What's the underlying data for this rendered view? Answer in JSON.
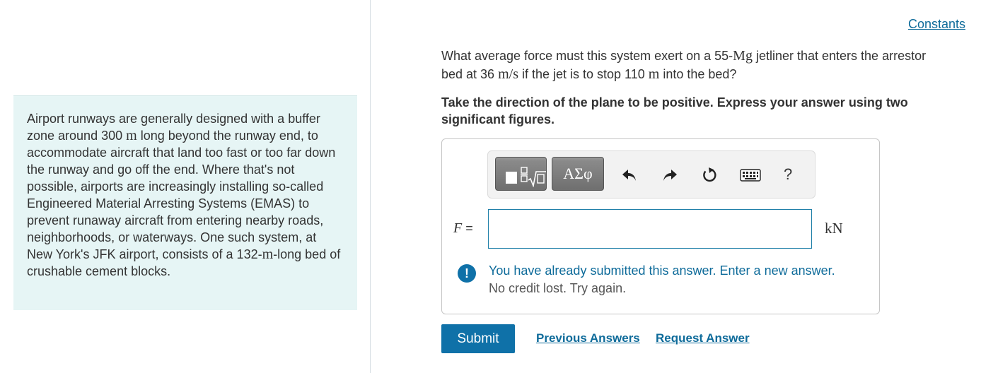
{
  "constants_link": "Constants",
  "intro": {
    "part1": "Airport runways are generally designed with a buffer zone around 300 ",
    "unit_m1": "m",
    "part2": " long beyond the runway end, to accommodate aircraft that land too fast or too far down the runway and go off the end. Where that's not possible, airports are increasingly installing so-called Engineered Material Arresting Systems (EMAS) to prevent runaway aircraft from entering nearby roads, neighborhoods, or waterways. One such system, at New York's JFK airport, consists of a 132-",
    "unit_m2": "m",
    "part3": "-long bed of crushable cement blocks."
  },
  "question": {
    "part1": "What average force must this system exert on a 55-",
    "unit_mg": "Mg",
    "part2": " jetliner that enters the arrestor bed at 36 ",
    "unit_ms": "m/s",
    "part3": " if the jet is to stop 110 ",
    "unit_m": "m",
    "part4": " into the bed?"
  },
  "instructions": "Take the direction of the plane to be positive. Express your answer using two significant figures.",
  "toolbar": {
    "greek_label": "ΑΣφ",
    "help_label": "?"
  },
  "answer": {
    "variable": "F",
    "equals": " =",
    "value": "",
    "unit": "kN"
  },
  "alert": {
    "icon": "!",
    "line1": "You have already submitted this answer. Enter a new answer.",
    "line2": "No credit lost. Try again."
  },
  "actions": {
    "submit": "Submit",
    "previous": "Previous Answers",
    "request": "Request Answer"
  }
}
